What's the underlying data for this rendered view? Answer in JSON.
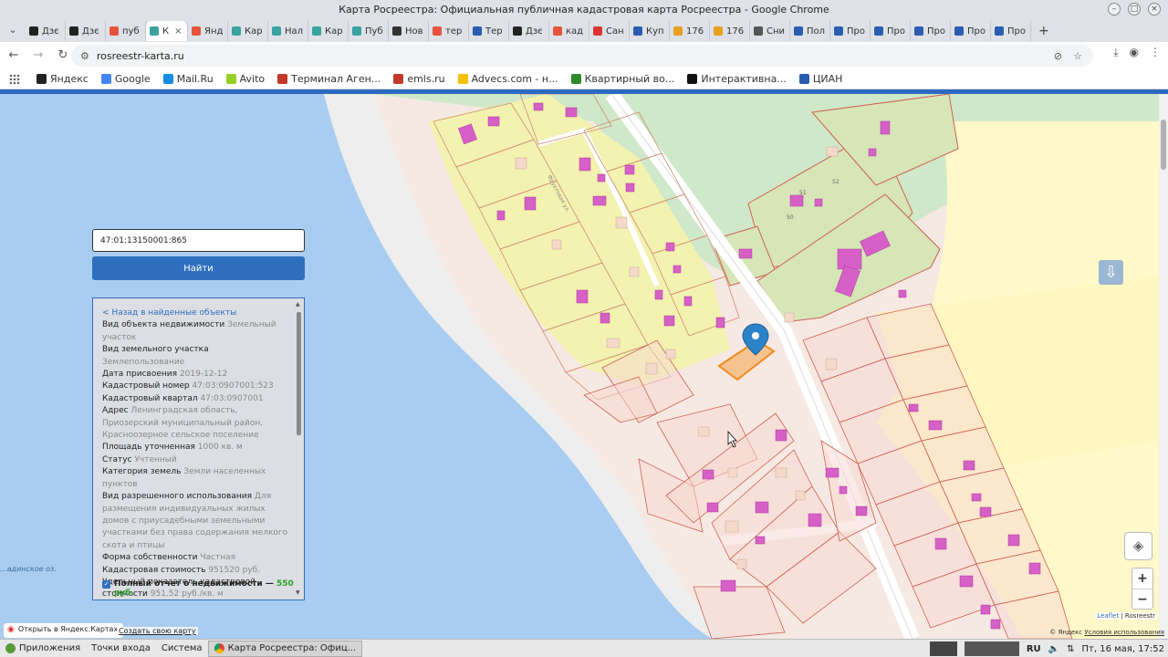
{
  "window": {
    "title": "Карта Росреестра: Официальная публичная кадастровая карта Росреестра - Google Chrome"
  },
  "tabs": [
    {
      "label": "Дзє",
      "icon": "zen-icon",
      "color": "#222222"
    },
    {
      "label": "Дзє",
      "icon": "zen-icon",
      "color": "#222222"
    },
    {
      "label": "пуб",
      "icon": "yandex-icon",
      "color": "#e5533d"
    },
    {
      "label": "К",
      "icon": "rosreestr-icon",
      "color": "#3aa3a0",
      "active": true
    },
    {
      "label": "Янд",
      "icon": "map-pin-icon",
      "color": "#e5533d"
    },
    {
      "label": "Кар",
      "icon": "rosreestr-icon",
      "color": "#3aa3a0"
    },
    {
      "label": "Нал",
      "icon": "rosreestr-icon",
      "color": "#3aa3a0"
    },
    {
      "label": "Кар",
      "icon": "rosreestr-icon",
      "color": "#3aa3a0"
    },
    {
      "label": "Пуб",
      "icon": "rosreestr-icon",
      "color": "#3aa3a0"
    },
    {
      "label": "Нов",
      "icon": "github-icon",
      "color": "#333333"
    },
    {
      "label": "тер",
      "icon": "yandex-icon",
      "color": "#e5533d"
    },
    {
      "label": "Тер",
      "icon": "arrow-icon",
      "color": "#2a5db0"
    },
    {
      "label": "Дзє",
      "icon": "zen-icon",
      "color": "#222222"
    },
    {
      "label": "кад",
      "icon": "yandex-icon",
      "color": "#e5533d"
    },
    {
      "label": "Сан",
      "icon": "record-icon",
      "color": "#d33"
    },
    {
      "label": "Куп",
      "icon": "cian-icon",
      "color": "#2a5db0"
    },
    {
      "label": "176",
      "icon": "flag-icon",
      "color": "#e8a020"
    },
    {
      "label": "176",
      "icon": "flag-icon",
      "color": "#e8a020"
    },
    {
      "label": "Сни",
      "icon": "globe-icon",
      "color": "#555555"
    },
    {
      "label": "Пол",
      "icon": "cian-icon",
      "color": "#2a5db0"
    },
    {
      "label": "Про",
      "icon": "cian-icon",
      "color": "#2a5db0"
    },
    {
      "label": "Про",
      "icon": "cian-icon",
      "color": "#2a5db0"
    },
    {
      "label": "Про",
      "icon": "cian-icon",
      "color": "#2a5db0"
    },
    {
      "label": "Про",
      "icon": "cian-icon",
      "color": "#2a5db0"
    },
    {
      "label": "Про",
      "icon": "cian-icon",
      "color": "#2a5db0"
    }
  ],
  "toolbar": {
    "url": "rosreestr-karta.ru"
  },
  "bookmarks": [
    {
      "label": "Яндекс",
      "color": "#222222"
    },
    {
      "label": "Google",
      "color": "#4285f4"
    },
    {
      "label": "Mail.Ru",
      "color": "#168de2"
    },
    {
      "label": "Avito",
      "color": "#97cf26"
    },
    {
      "label": "Терминал Аген...",
      "color": "#c0392b"
    },
    {
      "label": "emls.ru",
      "color": "#c0392b"
    },
    {
      "label": "Advecs.com - н...",
      "color": "#f2c200"
    },
    {
      "label": "Квартирный во...",
      "color": "#2d8a2d"
    },
    {
      "label": "Интерактивна...",
      "color": "#111111"
    },
    {
      "label": "ЦИАН",
      "color": "#2a5db0"
    }
  ],
  "search": {
    "value": "47:01:13150001:865",
    "button": "Найти"
  },
  "info": {
    "back": "< Назад в найденные объекты",
    "rows": [
      {
        "label": "Вид объекта недвижимости",
        "value": "Земельный участок"
      },
      {
        "label": "Вид земельного участка",
        "value": "Землепользование"
      },
      {
        "label": "Дата присвоения",
        "value": "2019-12-12"
      },
      {
        "label": "Кадастровый номер",
        "value": "47:03:0907001:523"
      },
      {
        "label": "Кадастровый квартал",
        "value": "47:03:0907001"
      },
      {
        "label": "Адрес",
        "value": "Ленинградская область, Приозерский муниципальный район, Красноозерное сельское поселение"
      },
      {
        "label": "Площадь уточненная",
        "value": "1000 кв. м"
      },
      {
        "label": "Статус",
        "value": "Учтенный"
      },
      {
        "label": "Категория земель",
        "value": "Земли населенных пунктов"
      },
      {
        "label": "Вид разрешенного использования",
        "value": "Для размещения индивидуальных жилых домов с приусадебными земельными участками без права содержания мелкого скота и птицы"
      },
      {
        "label": "Форма собственности",
        "value": "Частная"
      },
      {
        "label": "Кадастровая стоимость",
        "value": "951520 руб."
      },
      {
        "label": "Удельный показатель кадастровой стоимости",
        "value": "951.52 руб./кв. м"
      }
    ],
    "collapse": "▲",
    "report_label": "Полный отчет о недвижимости —",
    "report_price": "550 руб."
  },
  "map": {
    "street_label": "Фруктовая ул.",
    "plot_numbers": [
      "51",
      "52",
      "50"
    ],
    "lake_label": "...адинское оз.",
    "attribution_leaflet": "Leaflet",
    "attribution_sep": "| Rosreestr",
    "yandex_terms_prefix": "© Яндекс",
    "yandex_terms_link": "Условия использования",
    "open_yandex": "Открыть в Яндекс.Картах",
    "create_map": "Создать свою карту"
  },
  "taskbar": {
    "apps": "Приложения",
    "places": "Точки входа",
    "system": "Система",
    "task": "Карта Росреестра: Офиц...",
    "lang": "RU",
    "clock": "Пт, 16 мая, 17:52"
  },
  "colors": {
    "water": "#a9cdf0",
    "shore": "#f0f0f0",
    "settlement": "#f6e9e3",
    "field": "#fff7c7",
    "forest": "#cfe8c9",
    "plot_yellow": "#f6f3ad",
    "plot_pink": "#f7d8d2",
    "building": "#d760c7",
    "selected": "#f5a14a",
    "accent": "#2f6fbf"
  }
}
